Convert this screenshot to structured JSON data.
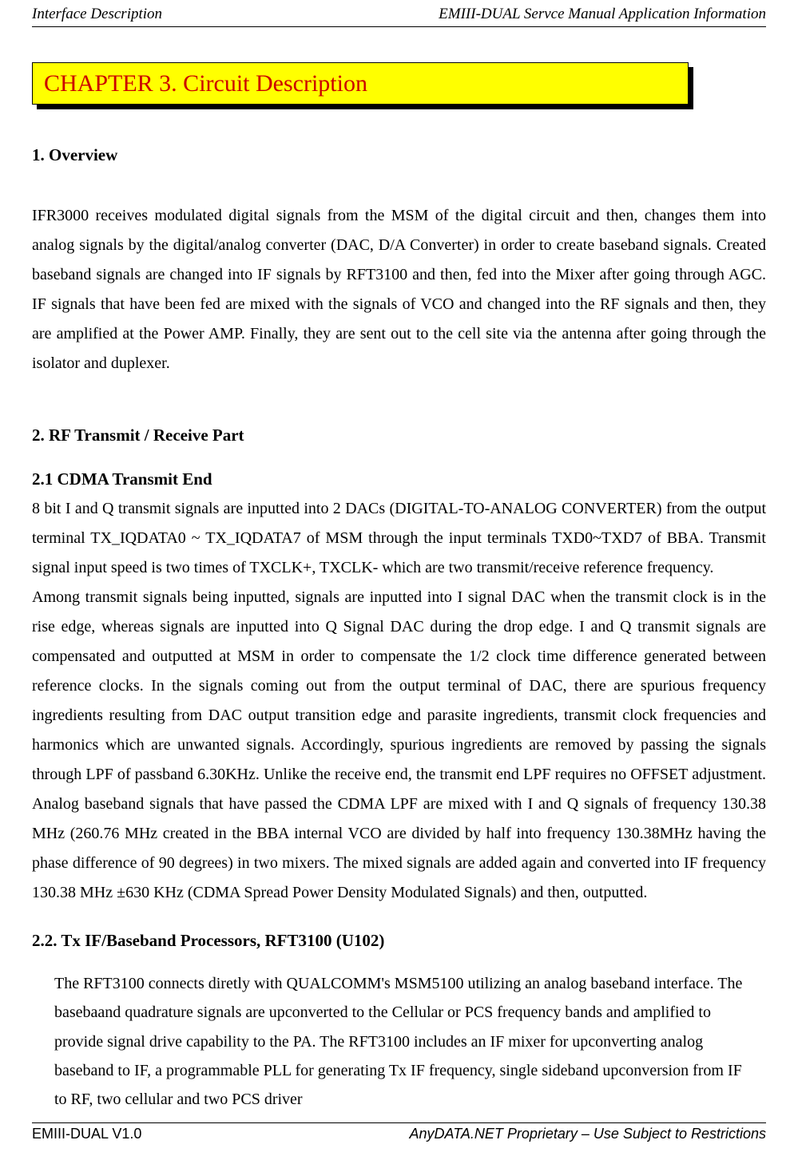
{
  "header": {
    "left": "Interface Description",
    "right": "EMIII-DUAL Servce Manual Application Information"
  },
  "chapter": {
    "title": "CHAPTER 3. Circuit Description"
  },
  "section1": {
    "title": "1. Overview",
    "body": "IFR3000 receives modulated digital signals from the MSM of the digital circuit and then, changes them into analog signals by the digital/analog converter (DAC, D/A Converter) in order to create baseband signals. Created baseband signals are changed into IF signals by RFT3100 and then, fed into the Mixer after going through AGC. IF signals that have been fed are mixed with the signals of VCO and changed into the RF signals and then, they are amplified at the Power AMP. Finally, they are sent out to the cell site via the antenna after going through the isolator and duplexer."
  },
  "section2": {
    "title": "2. RF Transmit / Receive Part",
    "sub21_title": "2.1 CDMA Transmit End",
    "sub21_body1": "8 bit I and Q transmit signals are inputted into 2 DACs (DIGITAL-TO-ANALOG CONVERTER) from the output terminal TX_IQDATA0 ~ TX_IQDATA7 of MSM through the input terminals TXD0~TXD7 of BBA. Transmit signal input speed is two times of TXCLK+, TXCLK- which are two transmit/receive reference frequency.",
    "sub21_body2": "Among transmit signals being inputted, signals are inputted into I signal DAC when the transmit clock is in the rise edge, whereas signals are inputted into Q Signal DAC during the drop edge. I and Q transmit signals are compensated and outputted at MSM in order to compensate the 1/2 clock time difference generated between reference clocks. In the signals coming out from the output terminal of DAC, there are spurious frequency ingredients resulting from DAC output transition edge and parasite ingredients, transmit clock frequencies and harmonics which are unwanted signals. Accordingly, spurious ingredients are removed by passing the signals through LPF of passband 6.30KHz. Unlike the receive end, the transmit end LPF requires no OFFSET adjustment. Analog baseband signals that have passed the CDMA LPF are mixed with I and Q signals of frequency 130.38 MHz (260.76 MHz created in the BBA internal VCO are divided by half into frequency 130.38MHz having the phase difference of 90 degrees) in two mixers. The mixed signals are added again and converted into IF frequency 130.38 MHz ±630 KHz (CDMA Spread Power Density Modulated Signals) and then, outputted.",
    "sub22_title": "2.2. Tx IF/Baseband Processors, RFT3100 (U102)",
    "sub22_body": "The RFT3100 connects diretly with QUALCOMM's MSM5100 utilizing an analog baseband interface. The basebaand quadrature signals are upconverted to the Cellular or PCS frequency bands and amplified to provide signal drive capability to the PA. The RFT3100 includes an IF mixer for upconverting analog baseband to IF, a programmable PLL for generating Tx IF frequency, single sideband upconversion from IF to RF, two cellular and two PCS driver"
  },
  "footer": {
    "left": "EMIII-DUAL V1.0",
    "right": "AnyDATA.NET Proprietary –  Use Subject to Restrictions"
  }
}
